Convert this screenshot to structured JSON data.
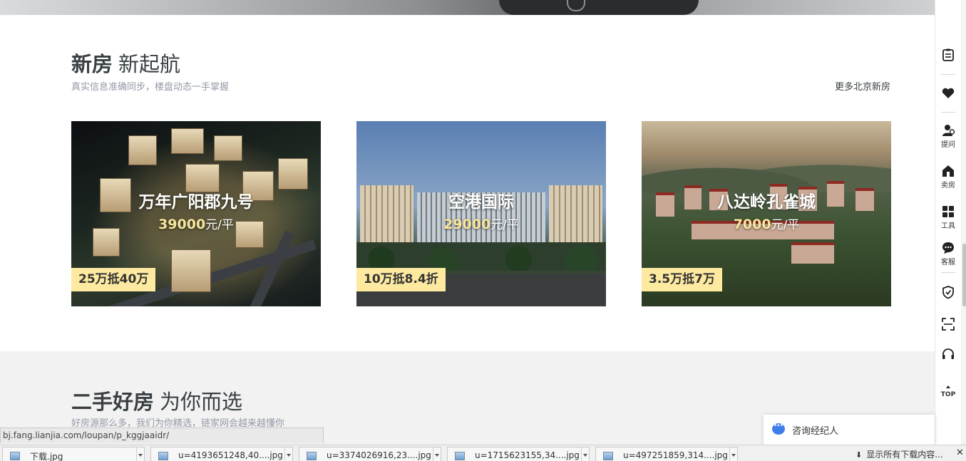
{
  "new_homes": {
    "title_bold": "新房",
    "title_light": "新起航",
    "subtitle": "真实信息准确同步，楼盘动态一手掌握",
    "more_link": "更多北京新房",
    "cards": [
      {
        "name": "万年广阳郡九号",
        "price_num": "39000",
        "price_unit": "元/平",
        "tag": "25万抵40万"
      },
      {
        "name": "空港国际",
        "price_num": "29000",
        "price_unit": "元/平",
        "tag": "10万抵8.4折"
      },
      {
        "name": "八达岭孔雀城",
        "price_num": "7000",
        "price_unit": "元/平",
        "tag": "3.5万抵7万"
      }
    ]
  },
  "second_hand": {
    "title_bold": "二手好房",
    "title_light": "为你而选",
    "subtitle": "好房源那么多，我们为你精选，链家网会越来越懂你"
  },
  "sidebar": {
    "items": [
      {
        "icon": "clipboard-icon",
        "label": ""
      },
      {
        "icon": "heart-icon",
        "label": ""
      },
      {
        "icon": "question-person-icon",
        "label": "提问"
      },
      {
        "icon": "sell-house-icon",
        "label": "卖房"
      },
      {
        "icon": "tools-grid-icon",
        "label": "工具"
      },
      {
        "icon": "chat-bubble-icon",
        "label": "客服"
      },
      {
        "icon": "shield-icon",
        "label": ""
      },
      {
        "icon": "scan-icon",
        "label": ""
      },
      {
        "icon": "headset-icon",
        "label": ""
      },
      {
        "icon": "top-arrow-icon",
        "label": "TOP"
      }
    ]
  },
  "consult": {
    "label": "咨询经纪人"
  },
  "status_url": "bj.fang.lianjia.com/loupan/p_kggjaaidr/",
  "downloads": {
    "items": [
      "下载.jpg",
      "u=4193651248,40....jpg",
      "u=3374026916,23....jpg",
      "u=1715623155,34....jpg",
      "u=497251859,314....jpg"
    ],
    "show_all": "显示所有下载内容...",
    "close": "✕"
  }
}
